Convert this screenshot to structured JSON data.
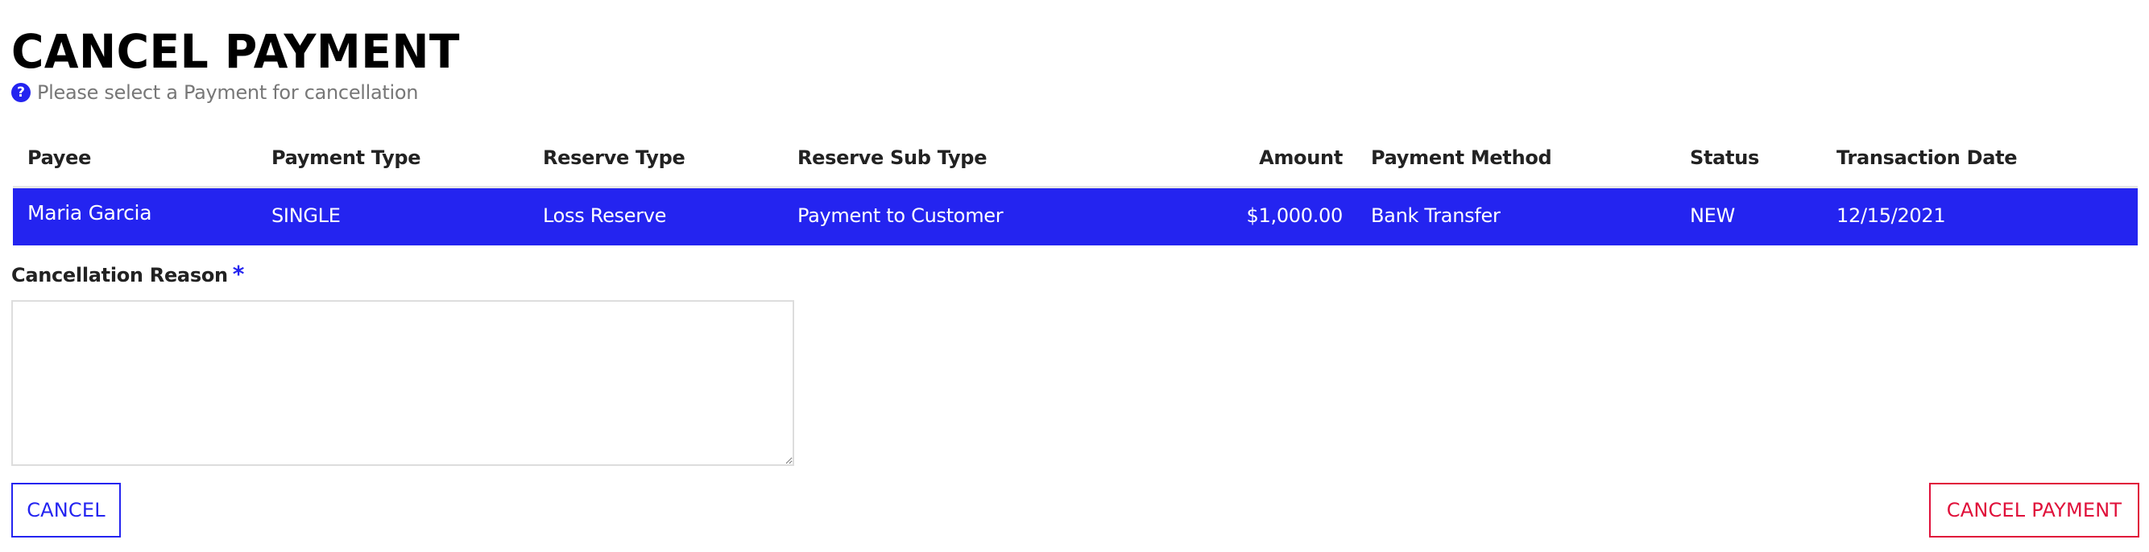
{
  "header": {
    "title": "CANCEL PAYMENT",
    "help_icon": "question-circle-icon",
    "subtitle": "Please select a Payment for cancellation"
  },
  "table": {
    "columns": [
      {
        "key": "payee",
        "label": "Payee"
      },
      {
        "key": "payment_type",
        "label": "Payment Type"
      },
      {
        "key": "reserve_type",
        "label": "Reserve Type"
      },
      {
        "key": "reserve_sub_type",
        "label": "Reserve Sub Type"
      },
      {
        "key": "amount",
        "label": "Amount"
      },
      {
        "key": "payment_method",
        "label": "Payment Method"
      },
      {
        "key": "status",
        "label": "Status"
      },
      {
        "key": "transaction_date",
        "label": "Transaction Date"
      }
    ],
    "rows": [
      {
        "selected": true,
        "payee": "Maria Garcia",
        "payment_type": "SINGLE",
        "reserve_type": "Loss Reserve",
        "reserve_sub_type": "Payment to Customer",
        "amount": "$1,000.00",
        "payment_method": "Bank Transfer",
        "status": "NEW",
        "transaction_date": "12/15/2021"
      }
    ]
  },
  "form": {
    "reason_label": "Cancellation Reason",
    "required_mark": "*",
    "reason_value": "",
    "reason_placeholder": ""
  },
  "actions": {
    "cancel_label": "CANCEL",
    "cancel_payment_label": "CANCEL PAYMENT"
  },
  "colors": {
    "accent": "#2424f0",
    "danger": "#e0103a",
    "selected_row_bg": "#2424f0",
    "muted_text": "#777777"
  }
}
